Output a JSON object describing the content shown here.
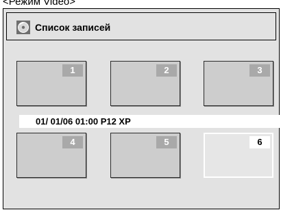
{
  "caption": "<Режим Video>",
  "window": {
    "title": "Список записей",
    "icon": "disc-icon"
  },
  "info": {
    "text": "01/ 01/06 01:00 P12 XP"
  },
  "thumbnails": [
    {
      "number": "1",
      "selected": false
    },
    {
      "number": "2",
      "selected": false
    },
    {
      "number": "3",
      "selected": false
    },
    {
      "number": "4",
      "selected": false
    },
    {
      "number": "5",
      "selected": false
    },
    {
      "number": "6",
      "selected": true
    }
  ],
  "colors": {
    "background": "#e2e2e2",
    "thumbnail": "#cdcdcd",
    "badge": "#a9a9a9",
    "selected": "#ffffff"
  }
}
